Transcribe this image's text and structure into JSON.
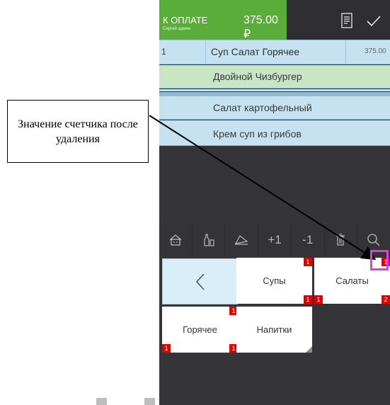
{
  "header": {
    "pay_label": "К ОПЛАТЕ",
    "user": "Сергей админ",
    "total": "375.00 ₽",
    "receipt_icon": "receipt-icon",
    "check_icon": "check-icon"
  },
  "order": {
    "qty": "1",
    "name": "Суп Салат Горячее",
    "price": "375.00"
  },
  "menu_rows": [
    {
      "label": "Двойной Чизбургер"
    },
    {
      "label": "Салат картофельный"
    },
    {
      "label": "Крем суп из грибов"
    }
  ],
  "toolbar": {
    "items": [
      {
        "icon": "home-icon"
      },
      {
        "icon": "bottles-icon"
      },
      {
        "icon": "dish-icon"
      },
      {
        "label": "+1"
      },
      {
        "label": "-1"
      },
      {
        "icon": "trash-icon"
      },
      {
        "icon": "search-icon"
      }
    ]
  },
  "tiles": {
    "back": {
      "label": "<"
    },
    "soups": {
      "label": "Супы",
      "badge_top": "1",
      "badge_bottom": "1"
    },
    "salads": {
      "label": "Салаты",
      "badge_top": "1",
      "badge_bottom_left": "1",
      "badge_bottom_right": "2"
    },
    "hot": {
      "label": "Горячее",
      "badge_top": "1",
      "badge_bottom_left": "1",
      "badge_bottom_right": "1"
    },
    "drinks": {
      "label": "Напитки"
    }
  },
  "callout": {
    "text": "Значение счетчика после удаления"
  },
  "colors": {
    "pay_green": "#5aad39",
    "row_blue": "#c6e2f1",
    "row_green": "#c8e6c3",
    "badge_red": "#e00000",
    "highlight_magenta": "#e33be0",
    "dark_bg": "#353438"
  }
}
